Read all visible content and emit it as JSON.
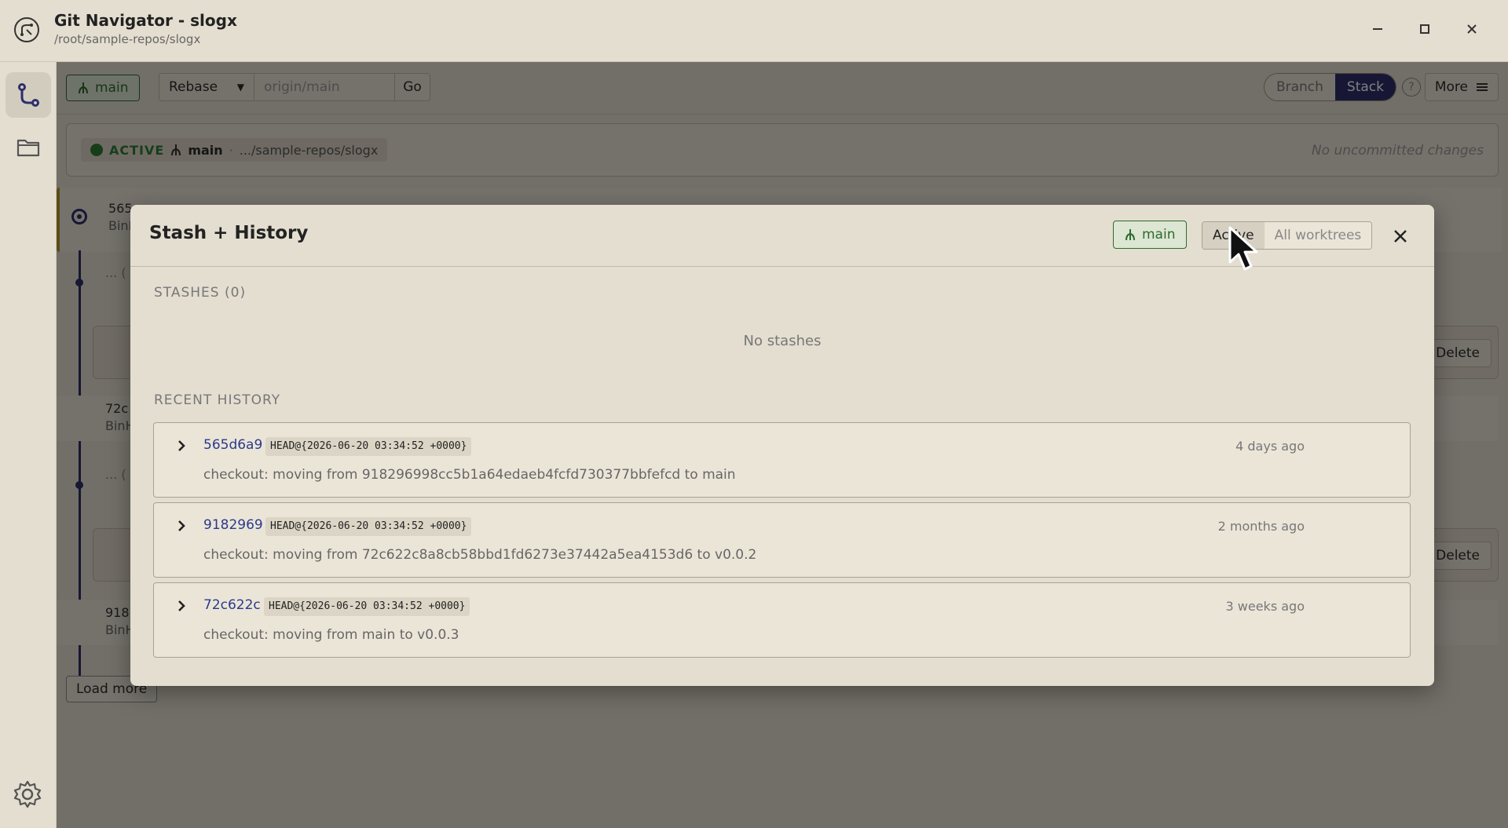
{
  "window": {
    "title": "Git Navigator - slogx",
    "path": "/root/sample-repos/slogx"
  },
  "toolbar": {
    "branch": "main",
    "operation": "Rebase",
    "target_placeholder": "origin/main",
    "go_label": "Go",
    "view_modes": [
      "Branch",
      "Stack"
    ],
    "active_view_mode": "Stack",
    "help_label": "?",
    "more_label": "More"
  },
  "worktree": {
    "status": "ACTIVE",
    "branch": "main",
    "separator": "·",
    "path": ".../sample-repos/slogx",
    "changes": "No uncommitted changes"
  },
  "background_list": {
    "commits": [
      {
        "hash_partial": "565",
        "author_partial": "BinH"
      },
      {
        "hash_partial": "72c",
        "author_partial": "BinH"
      },
      {
        "hash_partial": "918",
        "author_partial": "BinH"
      }
    ],
    "collapsed_label": "... (",
    "delete_label": "Delete",
    "load_more_label": "Load more"
  },
  "modal": {
    "title": "Stash + History",
    "branch": "main",
    "scope_options": [
      "Active",
      "All worktrees"
    ],
    "active_scope": "Active",
    "stashes_title": "STASHES (0)",
    "stashes_empty": "No stashes",
    "history_title": "RECENT HISTORY",
    "history": [
      {
        "hash": "565d6a9",
        "ref": "HEAD@{2026-06-20 03:34:52 +0000}",
        "when": "4 days ago",
        "message": "checkout: moving from 918296998cc5b1a64edaeb4fcfd730377bbfefcd to main"
      },
      {
        "hash": "9182969",
        "ref": "HEAD@{2026-06-20 03:34:52 +0000}",
        "when": "2 months ago",
        "message": "checkout: moving from 72c622c8a8cb58bbd1fd6273e37442a5ea4153d6 to v0.0.2"
      },
      {
        "hash": "72c622c",
        "ref": "HEAD@{2026-06-20 03:34:52 +0000}",
        "when": "3 weeks ago",
        "message": "checkout: moving from main to v0.0.3"
      }
    ]
  },
  "colors": {
    "accent": "#2e2e6b",
    "branch_green": "#2e6b2e",
    "hash_blue": "#2b3a8c",
    "background": "#e4ded0"
  }
}
